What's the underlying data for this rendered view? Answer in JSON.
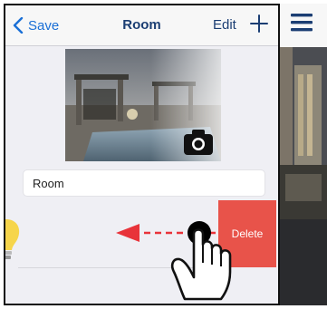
{
  "nav": {
    "back_label": "Save",
    "title": "Room",
    "edit_label": "Edit"
  },
  "room": {
    "name_value": "Room"
  },
  "row": {
    "delete_label": "Delete"
  },
  "colors": {
    "accent_blue": "#1a6fd6",
    "title_navy": "#1b3e73",
    "delete_red": "#e8534a",
    "arrow_red": "#e8333a",
    "background": "#efeff4"
  },
  "icons": [
    "chevron-left-icon",
    "plus-icon",
    "camera-icon",
    "hamburger-menu-icon",
    "lightbulb-icon",
    "hand-pointer-icon",
    "swipe-left-arrow-icon"
  ]
}
